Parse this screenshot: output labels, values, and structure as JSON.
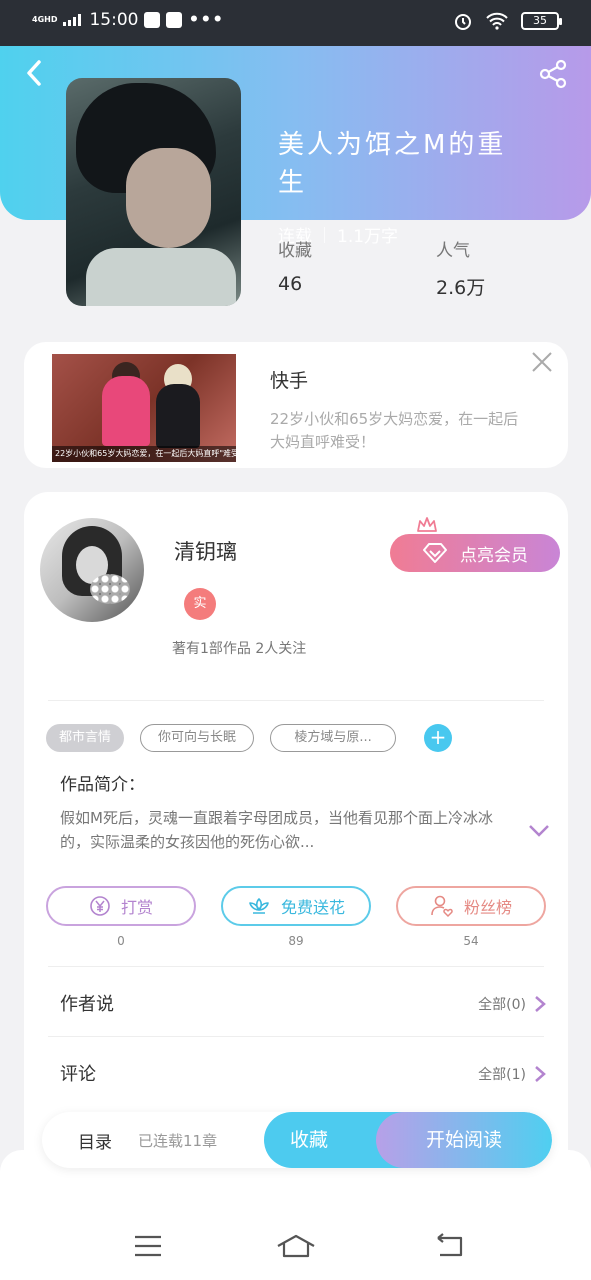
{
  "status_bar": {
    "network": "4GHD",
    "time": "15:00",
    "dots": "•••",
    "battery": "35"
  },
  "book": {
    "title": "美人为饵之M的重生",
    "status": "连载",
    "word_count": "1.1万字",
    "stats": [
      {
        "label": "收藏",
        "value": "46"
      },
      {
        "label": "人气",
        "value": "2.6万"
      }
    ]
  },
  "ad": {
    "title": "快手",
    "description": "22岁小伙和65岁大妈恋爱，在一起后\n大妈直呼难受！",
    "caption": "22岁小伙和65岁大妈恋爱，在一起后大妈直呼\"难受\"！"
  },
  "author": {
    "name": "清钥璃",
    "badge": "实",
    "stats": "著有1部作品 2人关注",
    "vip_label": "点亮会员"
  },
  "tags": [
    "都市言情",
    "你可向与长眠",
    "棱方域与原..."
  ],
  "tag_add": "+",
  "intro": {
    "label": "作品简介：",
    "text": "假如M死后，灵魂一直跟着字母团成员，当他看见那个面上冷冰冰的，实际温柔的女孩因他的死伤心欲..."
  },
  "actions": [
    {
      "label": "打赏",
      "count": "0"
    },
    {
      "label": "免费送花",
      "count": "89"
    },
    {
      "label": "粉丝榜",
      "count": "54"
    }
  ],
  "rows": {
    "author_says": {
      "label": "作者说",
      "right": "全部(0)"
    },
    "comments": {
      "label": "评论",
      "right": "全部(1)"
    }
  },
  "bottom_bar": {
    "catalog": "目录",
    "catalog_status": "已连载11章",
    "favorite": "收藏",
    "read": "开始阅读"
  },
  "colors": {
    "header_start": "#4fd1ee",
    "header_end": "#b79ae9",
    "accent_blue": "#4dcbef",
    "vip_pink": "#f07c94"
  },
  "icons": [
    "back-icon",
    "share-icon",
    "close-icon",
    "crown-icon",
    "diamond-icon",
    "yen-icon",
    "flower-icon",
    "fans-icon",
    "chevron-down-icon",
    "chevron-right-icon",
    "menu-icon",
    "home-icon",
    "return-icon"
  ]
}
